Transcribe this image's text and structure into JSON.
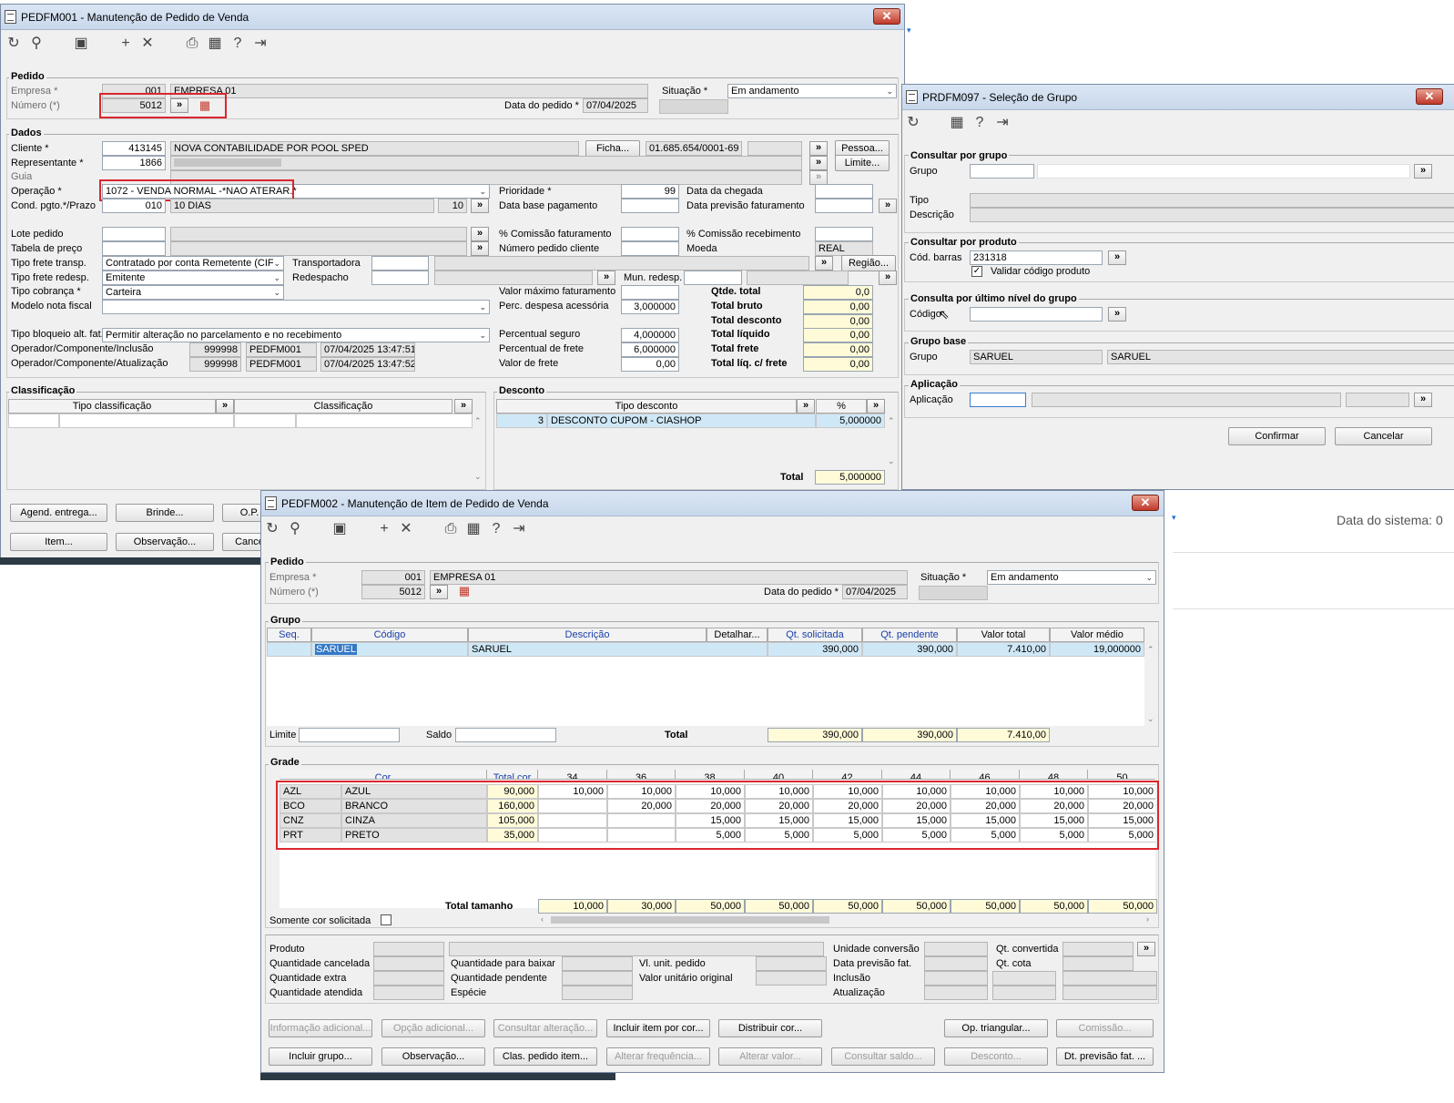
{
  "w1": {
    "title": "PEDFM001 - Manutenção de Pedido de Venda",
    "pedido": {
      "title": "Pedido",
      "empresa_label": "Empresa *",
      "empresa_code": "001",
      "empresa_name": "EMPRESA 01",
      "numero_label": "Número (*)",
      "numero": "5012",
      "data_label": "Data do pedido *",
      "data": "07/04/2025",
      "situacao_label": "Situação *",
      "situacao": "Em andamento"
    },
    "dados": {
      "title": "Dados",
      "cliente_label": "Cliente *",
      "cliente_code": "413145",
      "cliente_name": "NOVA CONTABILIDADE POR POOL SPED",
      "ficha": "Ficha...",
      "cnpj": "01.685.654/0001-69",
      "pessoa": "Pessoa...",
      "rep_label": "Representante *",
      "rep_code": "1866",
      "limite": "Limite...",
      "guia_label": "Guia",
      "op_label": "Operação *",
      "operacao": "1072 - VENDA NORMAL -*NAO ATERAR.*",
      "cond_label": "Cond. pgto.*/Prazo",
      "cond_code": "010",
      "cond_name": "10 DIAS",
      "prazo": "10",
      "prioridade_label": "Prioridade *",
      "prioridade": "99",
      "dbpag_label": "Data base pagamento",
      "dchegada_label": "Data da chegada",
      "dprev_label": "Data previsão faturamento",
      "lote_label": "Lote pedido",
      "tabela_label": "Tabela de preço",
      "com_fat_label": "% Comissão faturamento",
      "num_cli_label": "Número pedido cliente",
      "com_rec_label": "% Comissão recebimento",
      "moeda_label": "Moeda",
      "moeda": "REAL",
      "frete_label": "Tipo frete transp.",
      "frete": "Contratado por conta Remetente (CIF)",
      "transp_label": "Transportadora",
      "regiao": "Região...",
      "frete_redesp_label": "Tipo frete redesp.",
      "frete_redesp": "Emitente",
      "redesp_label": "Redespacho",
      "mun_redesp_label": "Mun. redesp.",
      "cobranca_label": "Tipo cobrança *",
      "cobranca": "Carteira",
      "modelo_label": "Modelo nota fiscal",
      "vmax_label": "Valor máximo faturamento",
      "perc_desp_label": "Perc. despesa acessória",
      "perc_desp": "3,000000",
      "bloqueio_label": "Tipo bloqueio alt. fat.",
      "bloqueio": "Permitir alteração no parcelamento e no recebimento",
      "perc_seg_label": "Percentual seguro",
      "perc_seg": "4,000000",
      "perc_frete_label": "Percentual de frete",
      "perc_frete": "6,000000",
      "valor_frete_label": "Valor de frete",
      "valor_frete": "0,00",
      "op_incl_label": "Operador/Componente/Inclusão",
      "op_incl_code": "999998",
      "op_incl_prog": "PEDFM001",
      "op_incl_dt": "07/04/2025 13:47:51",
      "op_atu_label": "Operador/Componente/Atualização",
      "op_atu_code": "999998",
      "op_atu_prog": "PEDFM001",
      "op_atu_dt": "07/04/2025 13:47:52",
      "totals": [
        {
          "label": "Qtde. total",
          "value": "0,0"
        },
        {
          "label": "Total bruto",
          "value": "0,00"
        },
        {
          "label": "Total desconto",
          "value": "0,00"
        },
        {
          "label": "Total líquido",
          "value": "0,00"
        },
        {
          "label": "Total frete",
          "value": "0,00"
        },
        {
          "label": "Total líq. c/ frete",
          "value": "0,00"
        }
      ]
    },
    "class": {
      "title": "Classificação",
      "col1": "Tipo classificação",
      "col2": "Classificação"
    },
    "desc": {
      "title": "Desconto",
      "col1": "Tipo desconto",
      "col2": "%",
      "row_code": "3",
      "row_name": "DESCONTO CUPOM - CIASHOP",
      "row_pct": "5,000000",
      "total_label": "Total",
      "total": "5,000000"
    },
    "buttons": {
      "agend": "Agend. entrega...",
      "brinde": "Brinde...",
      "op": "O.P.",
      "item": "Item...",
      "obs": "Observação...",
      "canc": "Cance"
    }
  },
  "w2": {
    "title": "PRDFM097 - Seleção de Grupo",
    "cg_title": "Consultar por grupo",
    "grupo_label": "Grupo",
    "tipo_label": "Tipo",
    "descricao_label": "Descrição",
    "cp_title": "Consultar por produto",
    "cod_barras_label": "Cód. barras",
    "cod_barras": "231318",
    "validar_label": "Validar código produto",
    "cu_title": "Consulta por último nível do grupo",
    "codigo_label": "Código",
    "gb_title": "Grupo base",
    "gb_grupo_label": "Grupo",
    "gb_code": "SARUEL",
    "gb_name": "SARUEL",
    "ap_title": "Aplicação",
    "ap_label": "Aplicação",
    "confirmar": "Confirmar",
    "cancelar": "Cancelar"
  },
  "bg": {
    "data_sistema": "Data do sistema: 0"
  },
  "w3": {
    "title": "PEDFM002 - Manutenção de Item de Pedido de Venda",
    "pedido": {
      "title": "Pedido",
      "empresa_label": "Empresa *",
      "empresa_code": "001",
      "empresa_name": "EMPRESA 01",
      "numero_label": "Número (*)",
      "numero": "5012",
      "data_label": "Data do pedido *",
      "data": "07/04/2025",
      "situacao_label": "Situação *",
      "situacao": "Em andamento"
    },
    "grupo": {
      "title": "Grupo",
      "headers": [
        "Seq.",
        "Código",
        "Descrição",
        "Detalhar...",
        "Qt. solicitada",
        "Qt. pendente",
        "Valor total",
        "Valor médio"
      ],
      "row": {
        "codigo": "SARUEL",
        "descricao": "SARUEL",
        "qt_sol": "390,000",
        "qt_pend": "390,000",
        "valor_total": "7.410,00",
        "valor_medio": "19,000000"
      },
      "limite_label": "Limite",
      "saldo_label": "Saldo",
      "total_label": "Total",
      "tot_sol": "390,000",
      "tot_pend": "390,000",
      "tot_valor": "7.410,00"
    },
    "grade": {
      "title": "Grade",
      "headers": [
        "Cor",
        "Total cor",
        "34",
        "36",
        "38",
        "40",
        "42",
        "44",
        "46",
        "48",
        "50"
      ],
      "rows": [
        {
          "code": "AZL",
          "name": "AZUL",
          "total": "90,000",
          "vals": [
            "10,000",
            "10,000",
            "10,000",
            "10,000",
            "10,000",
            "10,000",
            "10,000",
            "10,000",
            "10,000"
          ]
        },
        {
          "code": "BCO",
          "name": "BRANCO",
          "total": "160,000",
          "vals": [
            "",
            "20,000",
            "20,000",
            "20,000",
            "20,000",
            "20,000",
            "20,000",
            "20,000",
            "20,000"
          ]
        },
        {
          "code": "CNZ",
          "name": "CINZA",
          "total": "105,000",
          "vals": [
            "",
            "",
            "15,000",
            "15,000",
            "15,000",
            "15,000",
            "15,000",
            "15,000",
            "15,000"
          ]
        },
        {
          "code": "PRT",
          "name": "PRETO",
          "total": "35,000",
          "vals": [
            "",
            "",
            "5,000",
            "5,000",
            "5,000",
            "5,000",
            "5,000",
            "5,000",
            "5,000"
          ]
        }
      ],
      "total_tam_label": "Total tamanho",
      "total_tam": [
        "10,000",
        "30,000",
        "50,000",
        "50,000",
        "50,000",
        "50,000",
        "50,000",
        "50,000",
        "50,000"
      ],
      "somente_label": "Somente cor solicitada"
    },
    "info": {
      "produto": "Produto",
      "qtd_canc": "Quantidade cancelada",
      "qtd_extra": "Quantidade extra",
      "qtd_atend": "Quantidade atendida",
      "qtd_baixar": "Quantidade para baixar",
      "qtd_pend": "Quantidade pendente",
      "especie": "Espécie",
      "vl_unit": "Vl. unit. pedido",
      "vl_unit_orig": "Valor unitário original",
      "un_conv": "Unidade conversão",
      "dt_prev": "Data previsão fat.",
      "inclusao": "Inclusão",
      "atualizacao": "Atualização",
      "qt_conv": "Qt. convertida",
      "qt_cota": "Qt. cota"
    },
    "buttons_row1": [
      {
        "label": "Informação adicional...",
        "enabled": false
      },
      {
        "label": "Opção adicional...",
        "enabled": false
      },
      {
        "label": "Consultar alteração...",
        "enabled": false
      },
      {
        "label": "Incluir item por cor...",
        "enabled": true
      },
      {
        "label": "Distribuir cor...",
        "enabled": true
      },
      {
        "label": "Op. triangular...",
        "enabled": true
      },
      {
        "label": "Comissão...",
        "enabled": false
      }
    ],
    "buttons_row2": [
      {
        "label": "Incluir grupo...",
        "enabled": true
      },
      {
        "label": "Observação...",
        "enabled": true
      },
      {
        "label": "Clas. pedido item...",
        "enabled": true
      },
      {
        "label": "Alterar frequência...",
        "enabled": false
      },
      {
        "label": "Alterar valor...",
        "enabled": false
      },
      {
        "label": "Consultar saldo...",
        "enabled": false
      },
      {
        "label": "Desconto...",
        "enabled": false
      },
      {
        "label": "Dt. previsão fat. ...",
        "enabled": true
      }
    ]
  },
  "colors": {
    "accent_red": "#d9272e",
    "readonly_yellow": "#fffbd9",
    "selection": "#cfe8f7",
    "header_blue": "#1a3fa8"
  },
  "icons": [
    "refresh-icon",
    "search-icon",
    "save-icon",
    "add-icon",
    "delete-icon",
    "print-icon",
    "calendar-icon",
    "help-icon",
    "exit-icon"
  ]
}
